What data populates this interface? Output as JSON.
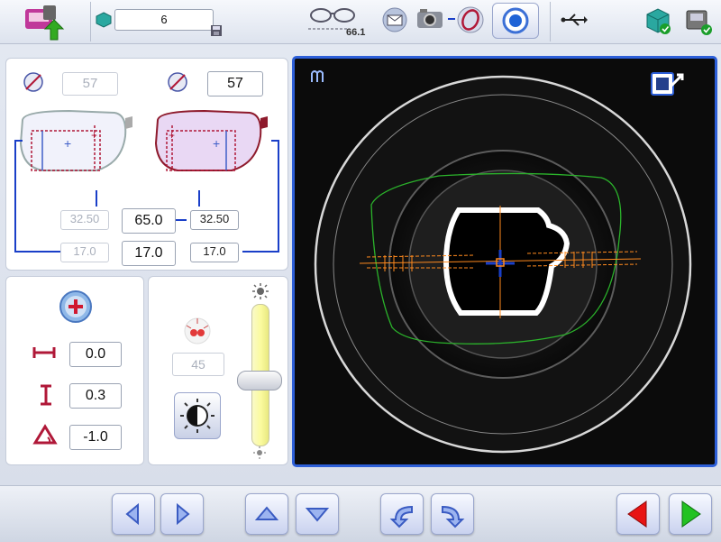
{
  "toolbar": {
    "job_number": "6",
    "frame_width_value": "66.1",
    "icons": [
      "home-upload-icon",
      "shape-icon",
      "save-icon",
      "frame-measure-icon",
      "email-icon",
      "camera-icon",
      "lens-shape-icon",
      "centering-target-icon",
      "usb-icon",
      "box-check-icon",
      "device-check-icon"
    ]
  },
  "lens_panel": {
    "left_diameter": "57",
    "right_diameter": "57",
    "pd_total": "65.0",
    "height_total": "17.0",
    "left_pd": "32.50",
    "right_pd": "32.50",
    "left_height": "17.0",
    "right_height": "17.0"
  },
  "offset_panel": {
    "horizontal": "0.0",
    "vertical": "0.3",
    "axis": "-1.0"
  },
  "light_panel": {
    "brightness": "45",
    "slider_level": 0.55
  },
  "colors": {
    "accent_blue": "#1a3fc8",
    "frame_red": "#a01830",
    "overlay_green": "#2bb32b",
    "overlay_orange": "#ff8a1e"
  }
}
